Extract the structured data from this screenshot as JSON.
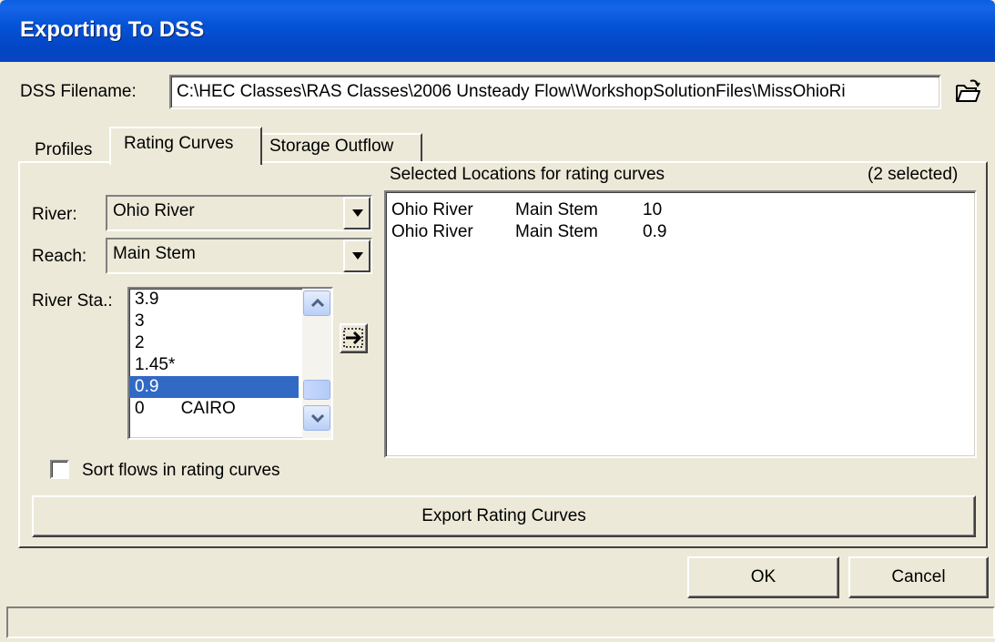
{
  "window": {
    "title": "Exporting To DSS"
  },
  "filename": {
    "label": "DSS Filename:",
    "value": "C:\\HEC Classes\\RAS Classes\\2006 Unsteady Flow\\WorkshopSolutionFiles\\MissOhioRi"
  },
  "tabs": [
    {
      "label": "Profiles",
      "active": false
    },
    {
      "label": "Rating Curves",
      "active": true
    },
    {
      "label": "Storage Outflow",
      "active": false
    }
  ],
  "river": {
    "label": "River:",
    "value": "Ohio River"
  },
  "reach": {
    "label": "Reach:",
    "value": "Main Stem"
  },
  "stations": {
    "label": "River Sta.:",
    "items": [
      {
        "sta": "3.9",
        "name": ""
      },
      {
        "sta": "3",
        "name": ""
      },
      {
        "sta": "2",
        "name": ""
      },
      {
        "sta": "1.45*",
        "name": ""
      },
      {
        "sta": "0.9",
        "name": ""
      },
      {
        "sta": "0",
        "name": "CAIRO"
      }
    ],
    "selected_index": 4
  },
  "selected_locations": {
    "header": "Selected Locations for rating curves",
    "count_text": "(2 selected)",
    "rows": [
      {
        "river": "Ohio River",
        "reach": "Main Stem",
        "sta": "10"
      },
      {
        "river": "Ohio River",
        "reach": "Main Stem",
        "sta": "0.9"
      }
    ]
  },
  "sort_checkbox": {
    "label": "Sort flows in rating curves",
    "checked": false
  },
  "buttons": {
    "export": "Export Rating Curves",
    "ok": "OK",
    "cancel": "Cancel"
  },
  "status": {
    "text": ""
  },
  "colors": {
    "title_bar": "#0553d6",
    "selection": "#316ac5",
    "window_bg": "#ece9d8"
  }
}
